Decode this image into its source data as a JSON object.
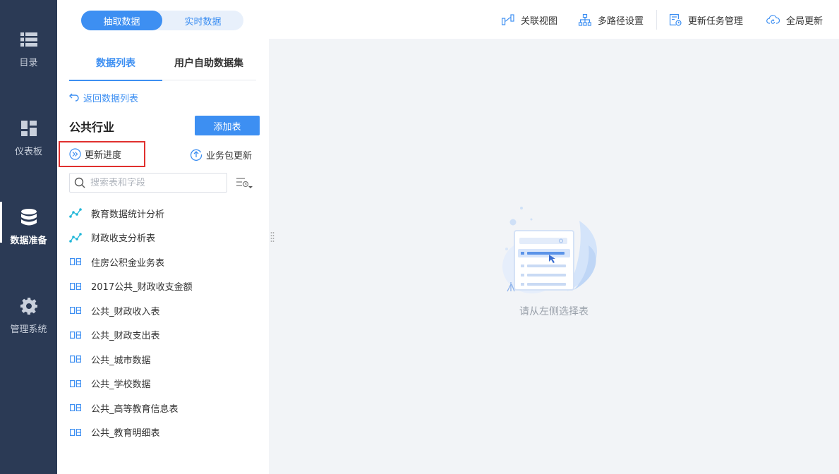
{
  "nav": {
    "items": [
      {
        "label": "目录",
        "icon": "list-icon"
      },
      {
        "label": "仪表板",
        "icon": "dashboard-icon"
      },
      {
        "label": "数据准备",
        "icon": "database-icon",
        "active": true
      },
      {
        "label": "管理系统",
        "icon": "gear-icon"
      }
    ]
  },
  "mode_switch": {
    "extract_label": "抽取数据",
    "realtime_label": "实时数据",
    "selected": "抽取数据"
  },
  "panel_tabs": {
    "data_list_label": "数据列表",
    "self_service_label": "用户自助数据集",
    "selected": "数据列表"
  },
  "back_link_label": "返回数据列表",
  "package": {
    "title": "公共行业",
    "add_table_label": "添加表",
    "progress_label": "更新进度",
    "package_update_label": "业务包更新"
  },
  "search": {
    "placeholder": "搜索表和字段",
    "value": ""
  },
  "tables": [
    {
      "label": "教育数据统计分析",
      "type": "analysis"
    },
    {
      "label": "财政收支分析表",
      "type": "analysis"
    },
    {
      "label": "住房公积金业务表",
      "type": "db"
    },
    {
      "label": "2017公共_财政收支金额",
      "type": "db"
    },
    {
      "label": "公共_财政收入表",
      "type": "db"
    },
    {
      "label": "公共_财政支出表",
      "type": "db"
    },
    {
      "label": "公共_城市数据",
      "type": "db"
    },
    {
      "label": "公共_学校数据",
      "type": "db"
    },
    {
      "label": "公共_高等教育信息表",
      "type": "db"
    },
    {
      "label": "公共_教育明细表",
      "type": "db"
    }
  ],
  "toolbar": {
    "relation_view_label": "关联视图",
    "multipath_label": "多路径设置",
    "task_mgmt_label": "更新任务管理",
    "global_update_label": "全局更新"
  },
  "empty_state": {
    "message": "请从左侧选择表"
  },
  "colors": {
    "accent": "#3d8ff2",
    "nav_bg": "#2b3a55",
    "highlight_box": "#e0302e",
    "analysis_icon": "#1fb6d8"
  }
}
